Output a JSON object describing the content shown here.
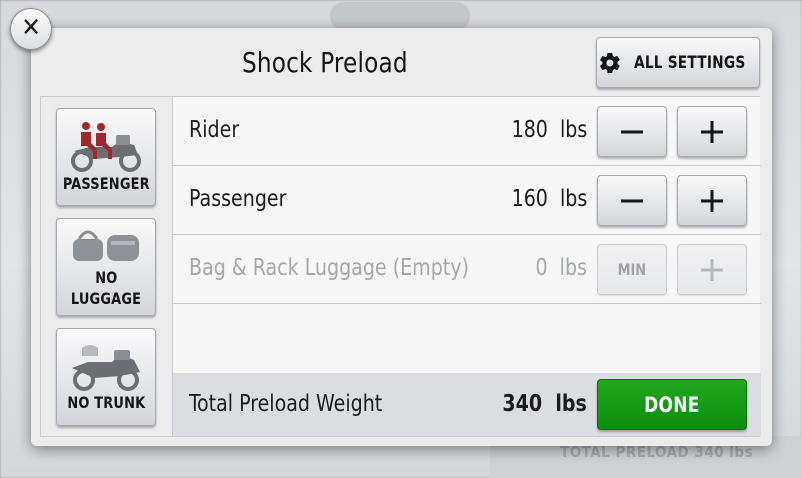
{
  "dialog": {
    "title": "Shock Preload",
    "all_settings_label": "ALL SETTINGS"
  },
  "modes": [
    {
      "label": "PASSENGER",
      "icon": "passenger-motorcycle-icon",
      "active": true
    },
    {
      "label_line1": "NO",
      "label_line2": "LUGGAGE",
      "icon": "luggage-icon"
    },
    {
      "label": "NO TRUNK",
      "icon": "motorcycle-trunk-icon"
    }
  ],
  "rows": [
    {
      "name": "Rider",
      "value": "180",
      "unit": "lbs"
    },
    {
      "name": "Passenger",
      "value": "160",
      "unit": "lbs"
    },
    {
      "name": "Bag & Rack Luggage (Empty)",
      "value": "0",
      "unit": "lbs",
      "min_label": "MIN"
    }
  ],
  "total": {
    "label": "Total Preload Weight",
    "value": "340",
    "unit": "lbs",
    "done_label": "DONE"
  },
  "background": {
    "footer_text": "TOTAL PRELOAD   340 lbs"
  },
  "colors": {
    "accent_green": "#149a16",
    "passenger_red": "#a3272f"
  }
}
